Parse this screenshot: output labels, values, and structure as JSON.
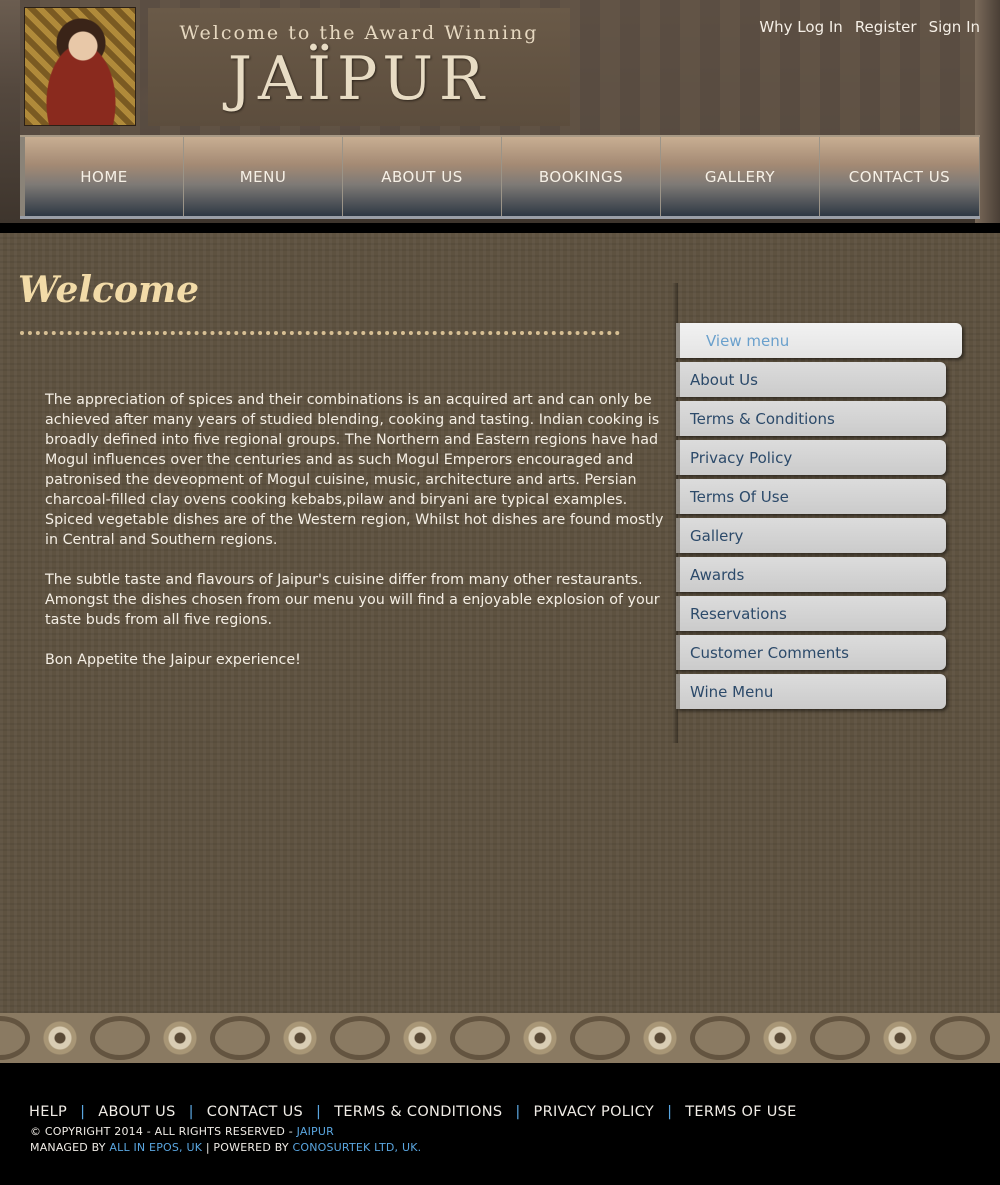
{
  "header": {
    "banner_welcome": "Welcome to the Award Winning",
    "banner_name": "JAÏPUR",
    "account_links": [
      "Why Log In",
      "Register",
      "Sign In"
    ]
  },
  "nav": {
    "items": [
      "HOME",
      "MENU",
      "ABOUT US",
      "BOOKINGS",
      "GALLERY",
      "CONTACT US"
    ]
  },
  "main": {
    "title": "Welcome",
    "paragraphs": [
      "The appreciation of spices and their combinations is an acquired art and can only be achieved after many years of studied blending, cooking and tasting. Indian cooking is broadly defined into five regional groups. The Northern and Eastern regions have had Mogul influences over the centuries and as such Mogul Emperors encouraged and patronised the deveopment of Mogul cuisine, music, architecture and arts. Persian charcoal-filled clay ovens cooking kebabs,pilaw and biryani are typical examples. Spiced vegetable dishes are of the Western region, Whilst hot dishes are found mostly in Central and Southern regions.",
      "The subtle taste and flavours of Jaipur's cuisine differ from many other restaurants. Amongst the dishes chosen from our menu you will find a enjoyable explosion of your taste buds from all five regions.",
      "Bon Appetite the Jaipur experience!"
    ]
  },
  "sidebar": {
    "items": [
      "View menu",
      "About Us",
      "Terms & Conditions",
      "Privacy Policy",
      "Terms Of Use",
      "Gallery",
      "Awards",
      "Reservations",
      "Customer Comments",
      "Wine Menu"
    ]
  },
  "footer": {
    "links": [
      "HELP",
      "ABOUT US",
      "CONTACT US",
      "TERMS & CONDITIONS",
      "PRIVACY POLICY",
      "TERMS OF USE"
    ],
    "separator": "|",
    "copyright_prefix": "© COPYRIGHT 2014 - ALL RIGHTS RESERVED - ",
    "copyright_link": "JAIPUR",
    "managed_prefix": "MANAGED BY ",
    "managed_link": "ALL IN EPOS, UK",
    "powered_prefix": " |  POWERED BY ",
    "powered_link": "CONOSURTEK LTD, UK."
  },
  "colors": {
    "accent_blue": "#5aa6e0",
    "welcome_gold": "#f2dba8",
    "sidebar_text": "#2c4a6a"
  }
}
